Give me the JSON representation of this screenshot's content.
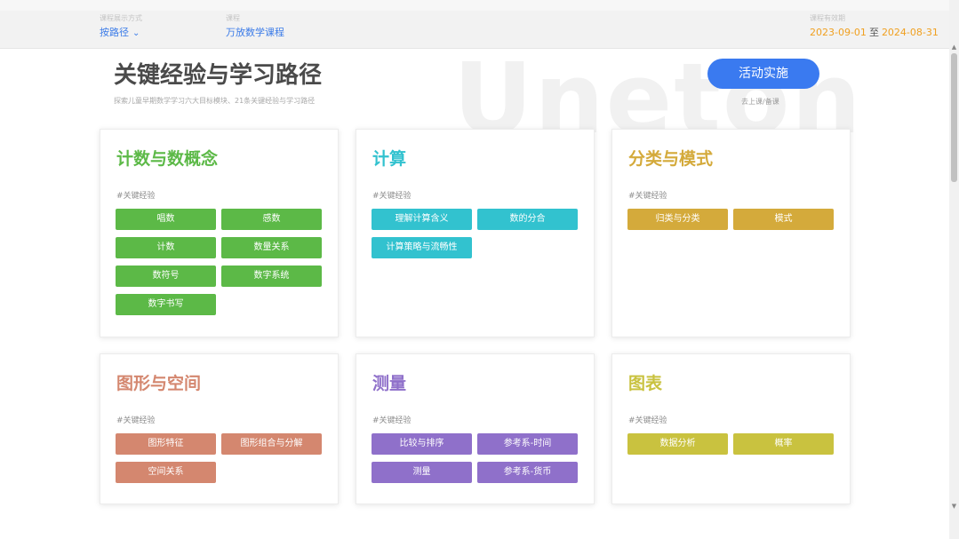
{
  "topbar": {
    "display_mode": {
      "label": "课程展示方式",
      "value": "按路径"
    },
    "course": {
      "label": "课程",
      "value": "万放数学课程"
    },
    "period": {
      "label": "课程有效期",
      "start": "2023-09-01",
      "sep": "至",
      "end": "2024-08-31"
    }
  },
  "header": {
    "watermark": "Uneton",
    "title": "关键经验与学习路径",
    "subtitle": "探索儿童早期数学学习六大目标模块、21条关键经验与学习路径",
    "action_label": "活动实施",
    "action_sub": "去上课/备课"
  },
  "cards": [
    {
      "title": "计数与数概念",
      "color": "#5cb947",
      "hash": "#关键经验",
      "tags": [
        "唱数",
        "感数",
        "计数",
        "数量关系",
        "数符号",
        "数字系统",
        "数字书写"
      ]
    },
    {
      "title": "计算",
      "color": "#32c2cf",
      "hash": "#关键经验",
      "tags": [
        "理解计算含义",
        "数的分合",
        "计算策略与流畅性"
      ]
    },
    {
      "title": "分类与模式",
      "color": "#d4aa3b",
      "hash": "#关键经验",
      "tags": [
        "归类与分类",
        "模式"
      ]
    },
    {
      "title": "图形与空间",
      "color": "#d4876f",
      "hash": "#关键经验",
      "tags": [
        "图形特征",
        "图形组合与分解",
        "空间关系"
      ]
    },
    {
      "title": "测量",
      "color": "#8f70ca",
      "hash": "#关键经验",
      "tags": [
        "比较与排序",
        "参考系-时间",
        "测量",
        "参考系-货币"
      ]
    },
    {
      "title": "图表",
      "color": "#c9c23f",
      "hash": "#关键经验",
      "tags": [
        "数据分析",
        "概率"
      ]
    }
  ],
  "icons": {
    "dropdown": "chevron-down-icon",
    "scroll_up": "arrow-up-icon",
    "scroll_down": "arrow-down-icon"
  }
}
